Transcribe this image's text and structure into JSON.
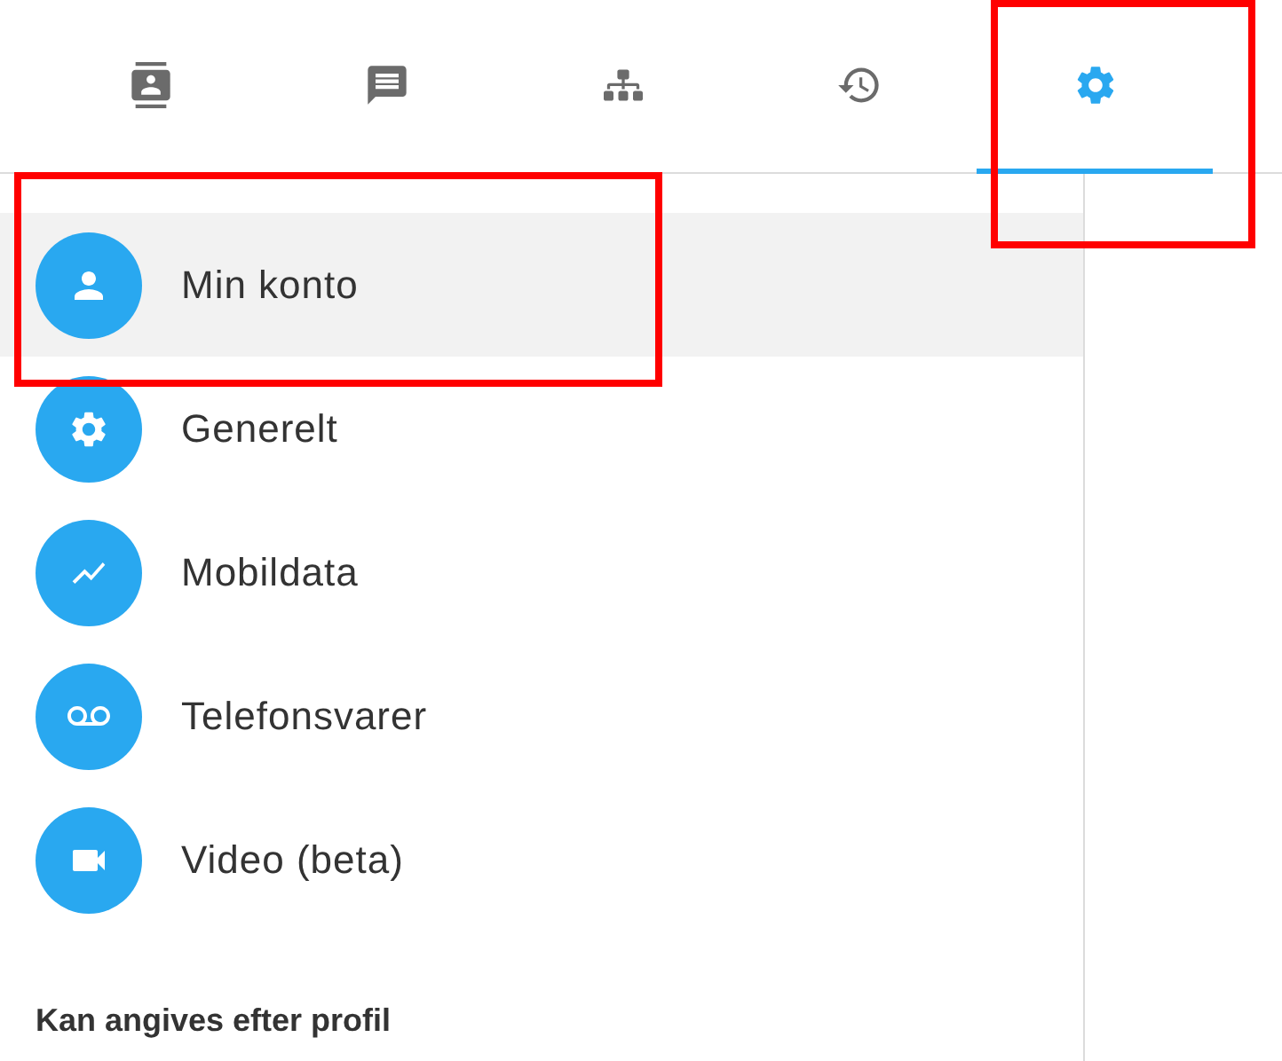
{
  "tabs": [
    {
      "kind": "contacts",
      "selected": false,
      "annotated": false
    },
    {
      "kind": "messages",
      "selected": false,
      "annotated": false
    },
    {
      "kind": "organization",
      "selected": false,
      "annotated": false
    },
    {
      "kind": "history",
      "selected": false,
      "annotated": false
    },
    {
      "kind": "settings",
      "selected": true,
      "annotated": true
    }
  ],
  "menu": [
    {
      "kind": "account",
      "label": "Min konto",
      "selected": true,
      "annotated": true
    },
    {
      "kind": "general",
      "label": "Generelt",
      "selected": false,
      "annotated": false
    },
    {
      "kind": "data",
      "label": "Mobildata",
      "selected": false,
      "annotated": false
    },
    {
      "kind": "voicemail",
      "label": "Telefonsvarer",
      "selected": false,
      "annotated": false
    },
    {
      "kind": "video",
      "label": "Video (beta)",
      "selected": false,
      "annotated": false
    }
  ],
  "section_header": "Kan angives efter profil"
}
